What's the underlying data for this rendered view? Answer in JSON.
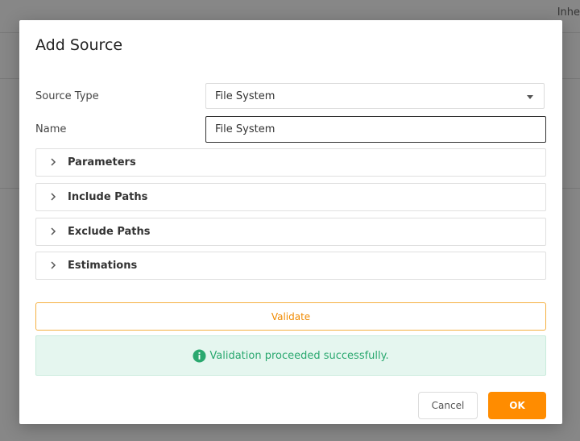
{
  "background": {
    "corner_text": "Inhe"
  },
  "dialog": {
    "title": "Add Source",
    "source_type_label": "Source Type",
    "source_type_value": "File System",
    "name_label": "Name",
    "name_value": "File System",
    "sections": [
      {
        "label": "Parameters"
      },
      {
        "label": "Include Paths"
      },
      {
        "label": "Exclude Paths"
      },
      {
        "label": "Estimations"
      }
    ],
    "validate_label": "Validate",
    "validation_message": "Validation proceeded successfully.",
    "cancel_label": "Cancel",
    "ok_label": "OK"
  },
  "colors": {
    "accent": "#ff8c00",
    "success": "#2aa86f",
    "success_bg": "#e5f6ef"
  }
}
